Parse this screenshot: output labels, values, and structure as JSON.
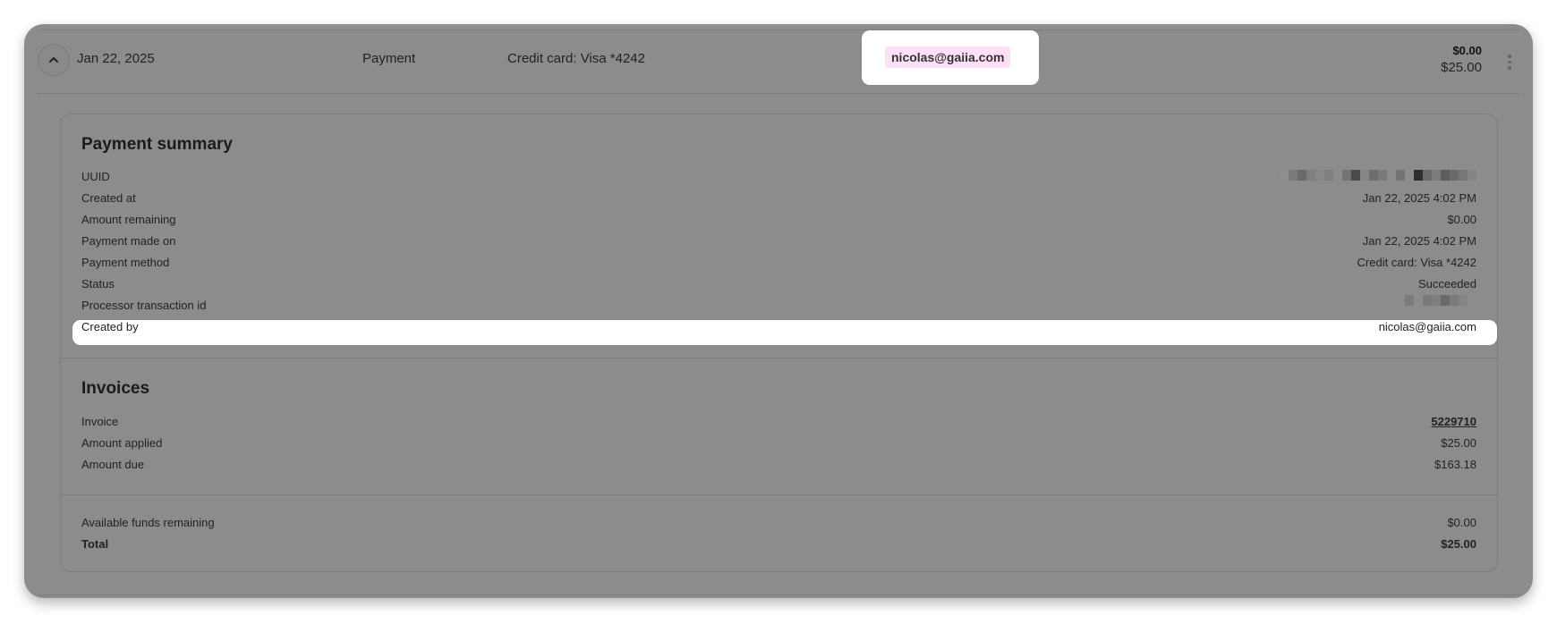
{
  "header": {
    "date": "Jan 22, 2025",
    "type": "Payment",
    "method": "Credit card: Visa *4242",
    "created_by_email": "nicolas@gaiia.com",
    "amount_remaining": "$0.00",
    "amount": "$25.00",
    "toggle_icon": "chevron-up-icon",
    "menu_icon": "more-vertical-icon"
  },
  "summary": {
    "title": "Payment summary",
    "rows": [
      {
        "label": "UUID",
        "value": ""
      },
      {
        "label": "Created at",
        "value": "Jan 22, 2025 4:02 PM"
      },
      {
        "label": "Amount remaining",
        "value": "$0.00"
      },
      {
        "label": "Payment made on",
        "value": "Jan 22, 2025 4:02 PM"
      },
      {
        "label": "Payment method",
        "value": "Credit card: Visa *4242"
      },
      {
        "label": "Status",
        "value": "Succeeded"
      },
      {
        "label": "Processor transaction id",
        "value": ""
      },
      {
        "label": "Created by",
        "value": "nicolas@gaiia.com"
      }
    ]
  },
  "invoices": {
    "title": "Invoices",
    "rows": [
      {
        "label": "Invoice",
        "value": "5229710"
      },
      {
        "label": "Amount applied",
        "value": "$25.00"
      },
      {
        "label": "Amount due",
        "value": "$163.18"
      }
    ]
  },
  "totals": {
    "rows": [
      {
        "label": "Available funds remaining",
        "value": "$0.00"
      },
      {
        "label": "Total",
        "value": "$25.00"
      }
    ]
  },
  "colors": {
    "overlay": "#8c8c8c",
    "highlight": "#ffffff",
    "email_chip": "#fde0f5"
  }
}
